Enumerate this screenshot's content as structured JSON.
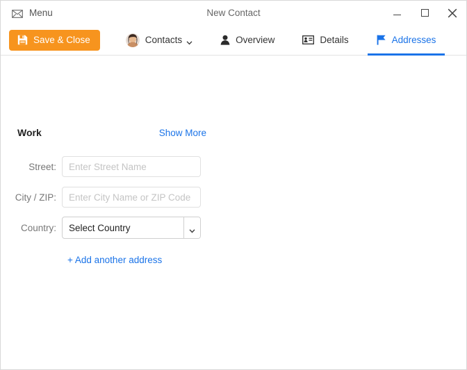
{
  "window": {
    "title": "New Contact",
    "menu_label": "Menu",
    "menu_icon": "envelope-icon",
    "controls": {
      "minimize": "minimize-icon",
      "maximize": "maximize-icon",
      "close": "close-icon"
    }
  },
  "toolbar": {
    "save_label": "Save & Close",
    "save_icon": "floppy-disk-icon",
    "save_color": "#f7941e",
    "accent_color": "#1a73e8",
    "tabs": [
      {
        "label": "Contacts",
        "icon": "avatar-photo",
        "has_chevron": true,
        "active": false
      },
      {
        "label": "Overview",
        "icon": "person-icon",
        "has_chevron": false,
        "active": false
      },
      {
        "label": "Details",
        "icon": "id-card-icon",
        "has_chevron": false,
        "active": false
      },
      {
        "label": "Addresses",
        "icon": "flag-icon",
        "has_chevron": false,
        "active": true
      }
    ]
  },
  "form": {
    "section_title": "Work",
    "show_more_label": "Show More",
    "fields": [
      {
        "label": "Street:",
        "placeholder": "Enter Street Name",
        "value": "",
        "type": "text"
      },
      {
        "label": "City / ZIP:",
        "placeholder": "Enter City Name or ZIP Code",
        "value": "",
        "type": "text"
      }
    ],
    "country": {
      "label": "Country:",
      "selected": "Select Country",
      "options": [
        "Select Country"
      ]
    },
    "add_another_label": "+ Add another address"
  }
}
